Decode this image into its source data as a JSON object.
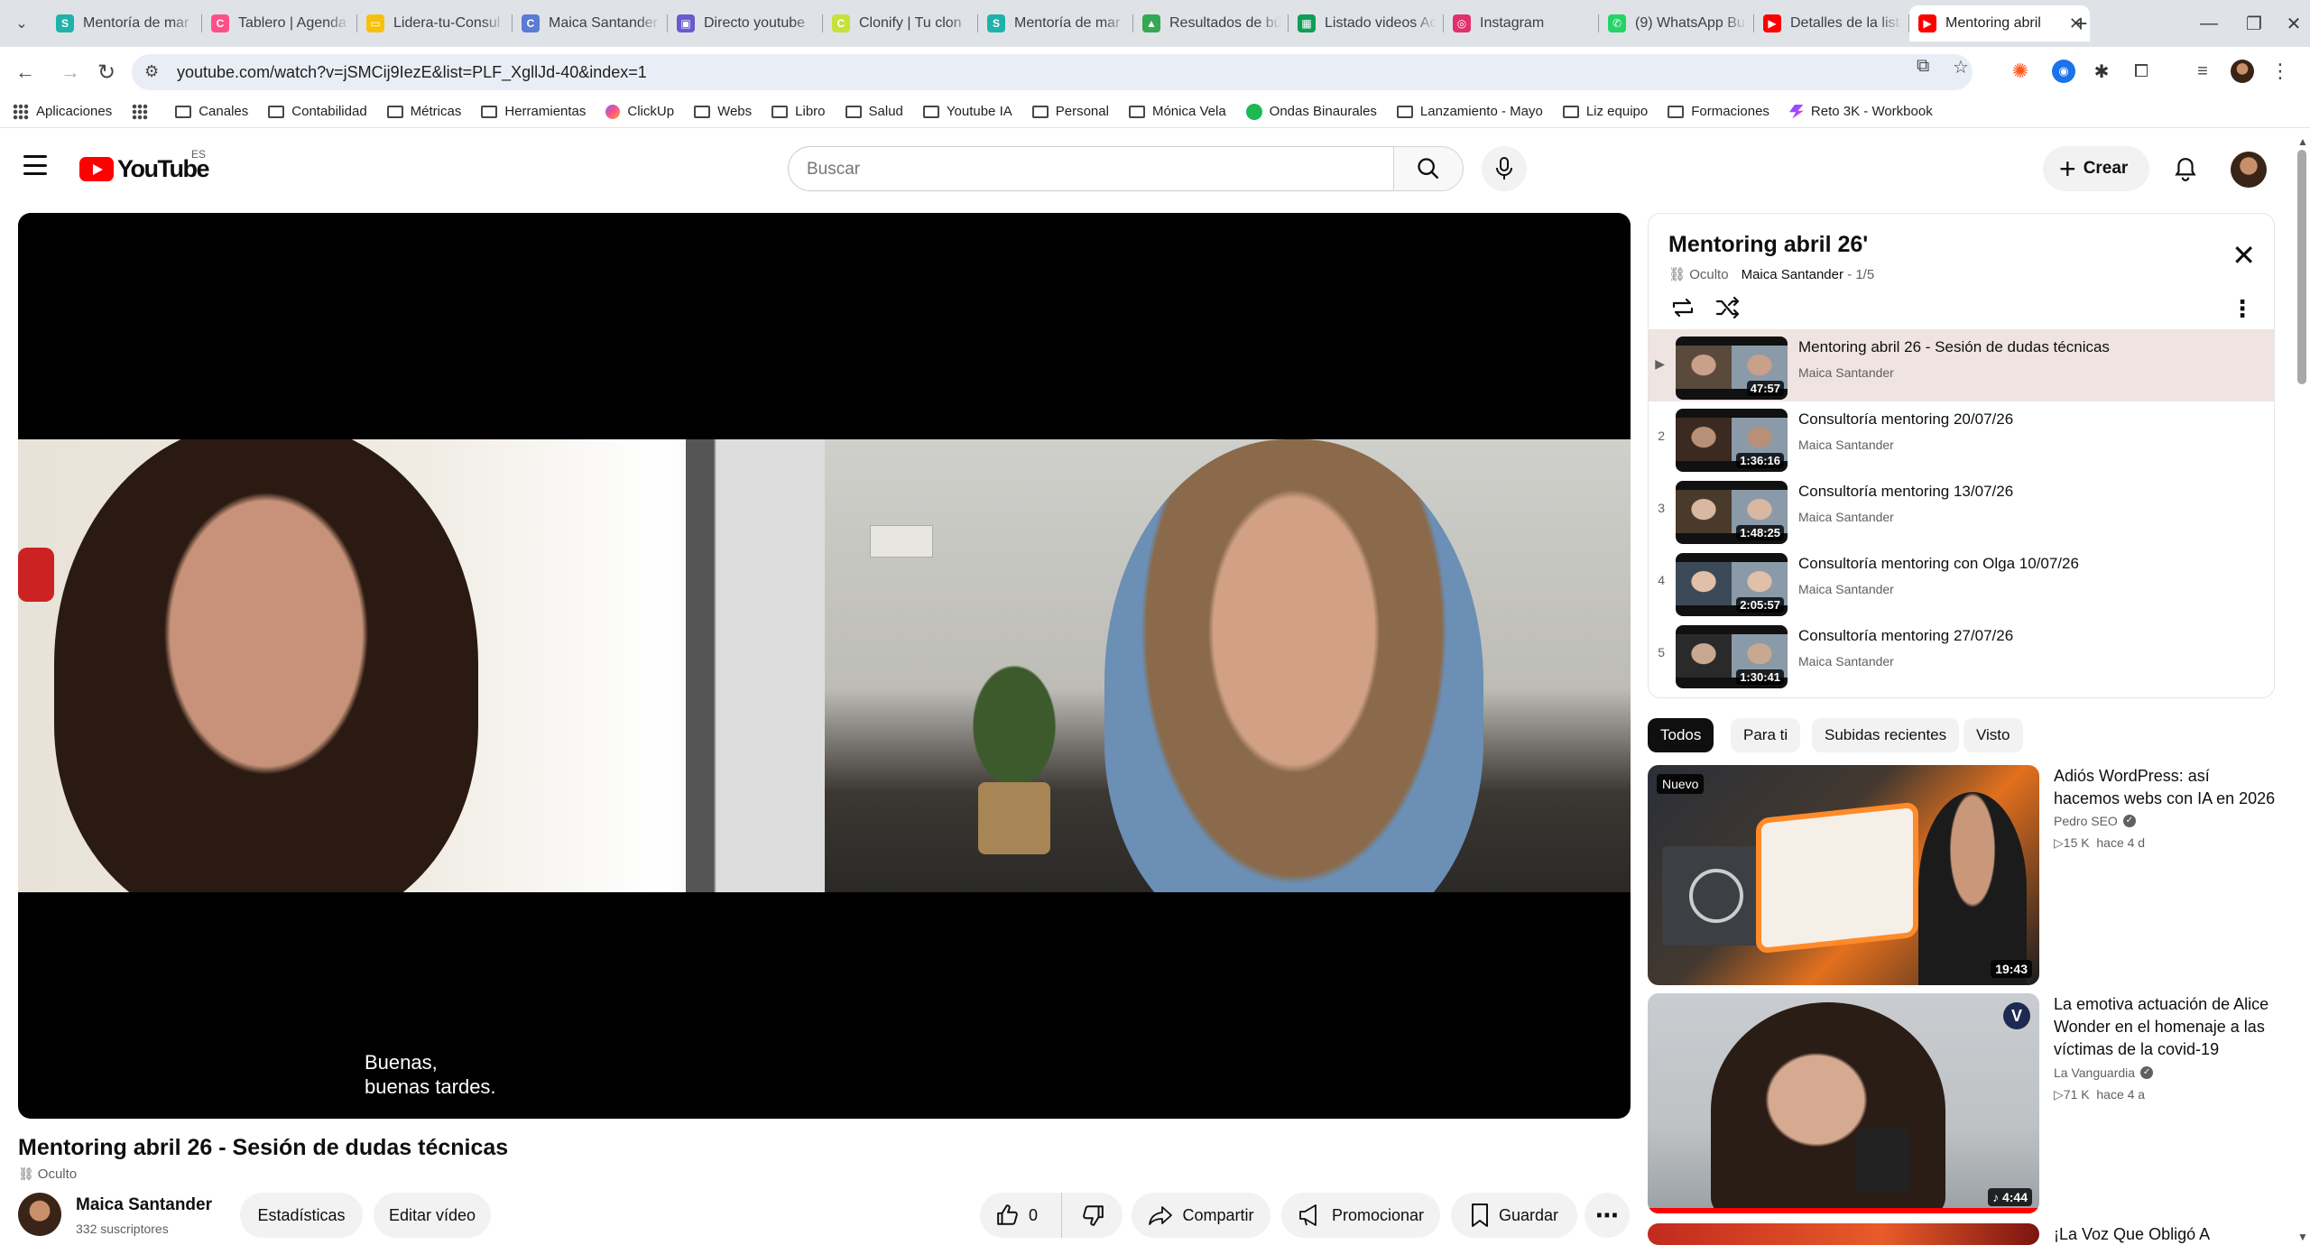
{
  "browser": {
    "tabs": [
      {
        "title": "Mentoría de mar",
        "fav_color": "#20b2aa",
        "fav_glyph": "S"
      },
      {
        "title": "Tablero | Agenda",
        "fav_color": "#ff4f8b",
        "fav_glyph": "C"
      },
      {
        "title": "Lidera-tu-Consul",
        "fav_color": "#f4c20d",
        "fav_glyph": "▭"
      },
      {
        "title": "Maica Santander",
        "fav_color": "#5b7bd5",
        "fav_glyph": "C"
      },
      {
        "title": "Directo youtube",
        "fav_color": "#6a5acd",
        "fav_glyph": "▣"
      },
      {
        "title": "Clonify | Tu clon",
        "fav_color": "#c6e23a",
        "fav_glyph": "C"
      },
      {
        "title": "Mentoría de mar",
        "fav_color": "#20b2aa",
        "fav_glyph": "S"
      },
      {
        "title": "Resultados de bú",
        "fav_color": "#34a853",
        "fav_glyph": "▲"
      },
      {
        "title": "Listado videos Ac",
        "fav_color": "#0f9d58",
        "fav_glyph": "▦"
      },
      {
        "title": "Instagram",
        "fav_color": "#e1306c",
        "fav_glyph": "◎"
      },
      {
        "title": "(9) WhatsApp Bu",
        "fav_color": "#25d366",
        "fav_glyph": "✆"
      },
      {
        "title": "Detalles de la list",
        "fav_color": "#ff0000",
        "fav_glyph": "▶"
      },
      {
        "title": "Mentoring abril",
        "fav_color": "#ff0000",
        "fav_glyph": "▶",
        "active": true
      }
    ],
    "url": "youtube.com/watch?v=jSMCij9IezE&list=PLF_XgllJd-40&index=1",
    "bookmarks": [
      {
        "label": "Aplicaciones",
        "icon": "apps-grid-icon"
      },
      {
        "label": "",
        "icon": "grid-icon"
      },
      {
        "label": "Canales",
        "icon": "folder-icon"
      },
      {
        "label": "Contabilidad",
        "icon": "folder-icon"
      },
      {
        "label": "Métricas",
        "icon": "folder-icon"
      },
      {
        "label": "Herramientas",
        "icon": "folder-icon"
      },
      {
        "label": "ClickUp",
        "icon": "clickup-icon"
      },
      {
        "label": "Webs",
        "icon": "folder-icon"
      },
      {
        "label": "Libro",
        "icon": "folder-icon"
      },
      {
        "label": "Salud",
        "icon": "folder-icon"
      },
      {
        "label": "Youtube IA",
        "icon": "folder-icon"
      },
      {
        "label": "Personal",
        "icon": "folder-icon"
      },
      {
        "label": "Mónica Vela",
        "icon": "folder-icon"
      },
      {
        "label": "Ondas Binaurales",
        "icon": "spotify-icon"
      },
      {
        "label": "Lanzamiento - Mayo",
        "icon": "folder-icon"
      },
      {
        "label": "Liz equipo",
        "icon": "folder-icon"
      },
      {
        "label": "Formaciones",
        "icon": "folder-icon"
      },
      {
        "label": "Reto 3K - Workbook",
        "icon": "reto-icon"
      }
    ]
  },
  "youtube": {
    "logo_text": "YouTube",
    "country": "ES",
    "search_placeholder": "Buscar",
    "create_label": "Crear",
    "player": {
      "subtitle_line1": "Buenas,",
      "subtitle_line2": "buenas tardes."
    },
    "video": {
      "title": "Mentoring abril 26 - Sesión de dudas técnicas",
      "visibility": "Oculto",
      "channel": "Maica Santander",
      "subscribers": "332 suscriptores",
      "stats_label": "Estadísticas",
      "edit_label": "Editar vídeo",
      "likes": "0",
      "share_label": "Compartir",
      "promote_label": "Promocionar",
      "save_label": "Guardar"
    },
    "playlist": {
      "title": "Mentoring abril 26'",
      "visibility": "Oculto",
      "owner": "Maica Santander",
      "position": "1/5",
      "items": [
        {
          "num": "▶",
          "title": "Mentoring abril 26 - Sesión de dudas técnicas",
          "channel": "Maica Santander",
          "duration": "47:57",
          "active": true
        },
        {
          "num": "2",
          "title": "Consultoría mentoring 20/07/26",
          "channel": "Maica Santander",
          "duration": "1:36:16"
        },
        {
          "num": "3",
          "title": "Consultoría mentoring 13/07/26",
          "channel": "Maica Santander",
          "duration": "1:48:25"
        },
        {
          "num": "4",
          "title": "Consultoría mentoring con Olga 10/07/26",
          "channel": "Maica Santander",
          "duration": "2:05:57"
        },
        {
          "num": "5",
          "title": "Consultoría mentoring 27/07/26",
          "channel": "Maica Santander",
          "duration": "1:30:41"
        }
      ]
    },
    "chips": [
      "Todos",
      "Para ti",
      "Subidas recientes",
      "Visto"
    ],
    "recommendations": [
      {
        "title": "Adiós WordPress: así hacemos webs con IA en 2026",
        "channel": "Pedro SEO",
        "views": "15 K",
        "age": "hace 4 d",
        "duration": "19:43",
        "badge": "Nuevo"
      },
      {
        "title": "La emotiva actuación de Alice Wonder en el homenaje a las víctimas de la covid-19",
        "channel": "La Vanguardia",
        "views": "71 K",
        "age": "hace 4 a",
        "duration": "4:44",
        "badge": ""
      },
      {
        "title": "¡La Voz Que Obligó A Alejandro",
        "channel": "",
        "views": "",
        "age": "",
        "duration": "",
        "badge": ""
      }
    ]
  }
}
